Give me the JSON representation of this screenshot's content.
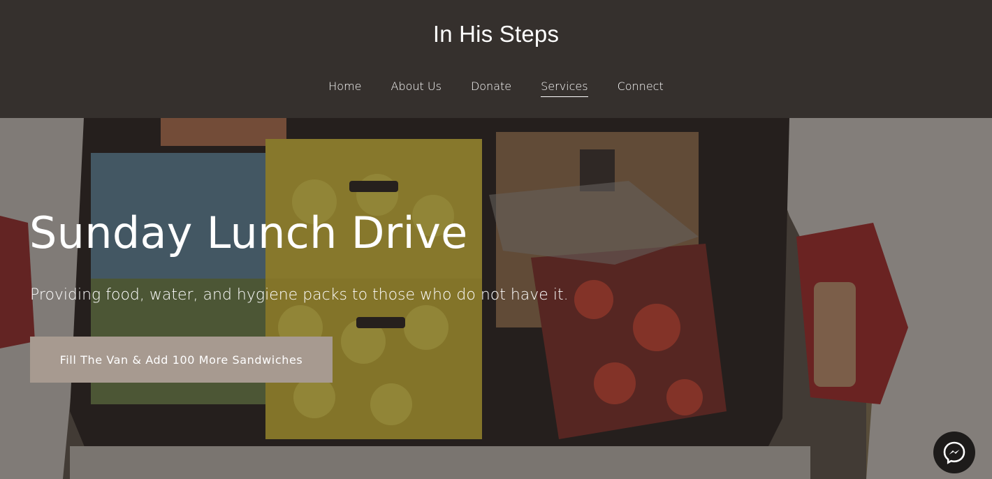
{
  "site": {
    "title": "In His Steps"
  },
  "nav": {
    "items": [
      {
        "label": "Home"
      },
      {
        "label": "About Us"
      },
      {
        "label": "Donate"
      },
      {
        "label": "Services",
        "active": true
      },
      {
        "label": "Connect"
      }
    ]
  },
  "hero": {
    "title": "Sunday Lunch Drive",
    "subtitle": "Providing food, water, and hygiene packs to those who do not have it.",
    "cta_label": "Fill The Van & Add 100 More Sandwiches"
  },
  "chat": {
    "icon": "messenger-icon"
  },
  "colors": {
    "header_bg": "#35302d",
    "cta_bg": "#a79a90",
    "text": "#ffffff"
  }
}
